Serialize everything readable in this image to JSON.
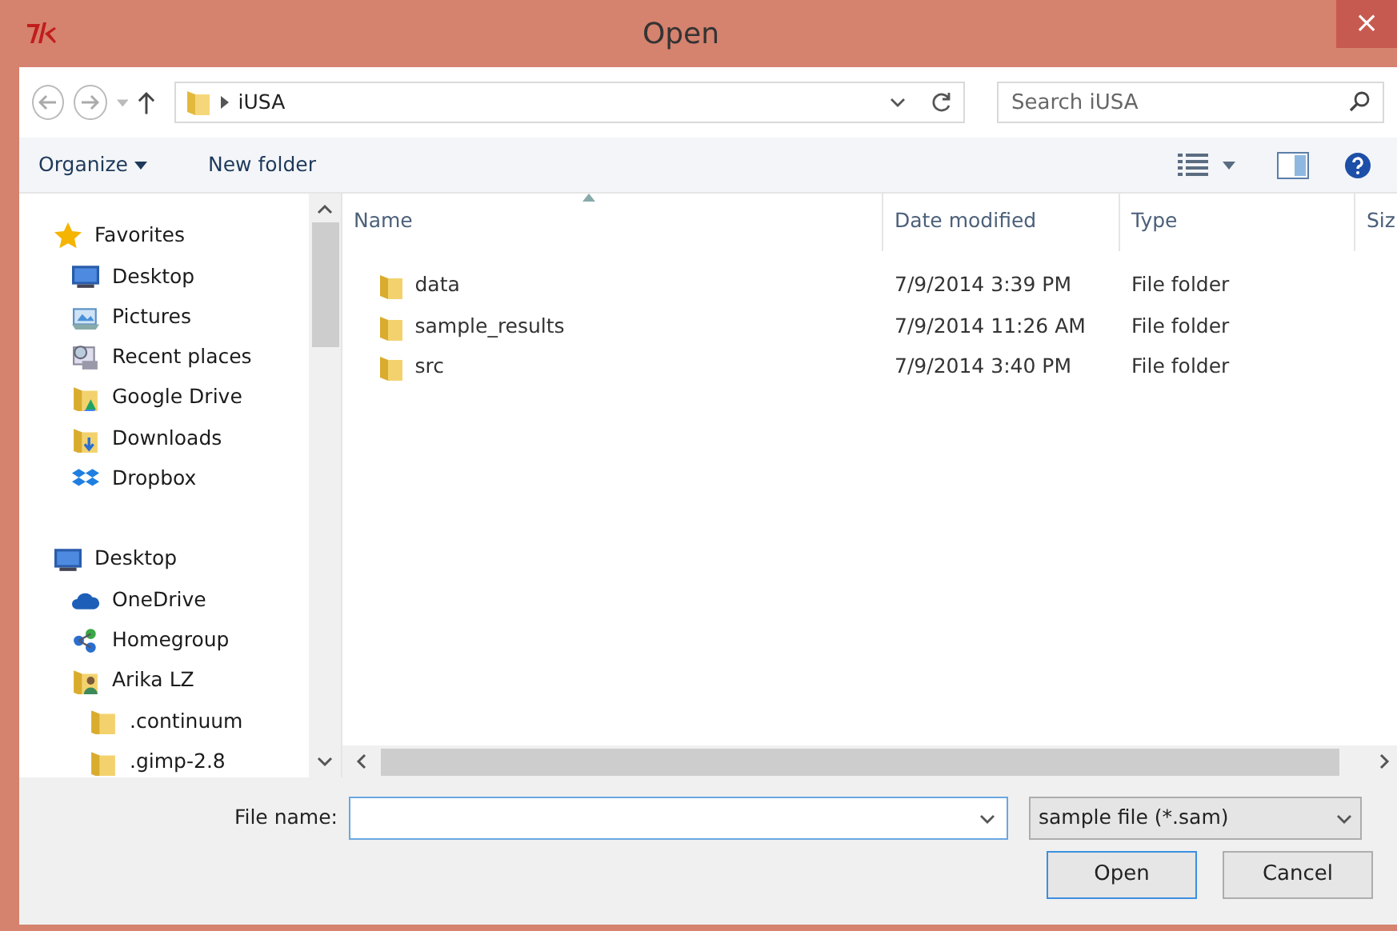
{
  "window": {
    "title": "Open",
    "close": "×"
  },
  "address_bar": {
    "path": "iUSA"
  },
  "search": {
    "placeholder": "Search iUSA"
  },
  "toolbar": {
    "buttons": [
      "Organize",
      "New folder"
    ]
  },
  "sidebar": {
    "groups": [
      {
        "label": "Favorites",
        "children": [
          {
            "label": "Desktop"
          },
          {
            "label": "Pictures"
          },
          {
            "label": "Recent places"
          },
          {
            "label": "Google Drive"
          },
          {
            "label": "Downloads"
          },
          {
            "label": "Dropbox"
          }
        ]
      },
      {
        "label": "Desktop",
        "children": [
          {
            "label": "OneDrive"
          },
          {
            "label": "Homegroup"
          },
          {
            "label": "Arika LZ",
            "children": [
              {
                "label": ".continuum"
              },
              {
                "label": ".gimp-2.8"
              }
            ]
          }
        ]
      }
    ]
  },
  "table": {
    "columns": [
      "Name",
      "Date modified",
      "Type",
      "Siz"
    ],
    "rows": [
      {
        "name": "data",
        "date_modified": "7/9/2014 3:39 PM",
        "type": "File folder"
      },
      {
        "name": "sample_results",
        "date_modified": "7/9/2014 11:26 AM",
        "type": "File folder"
      },
      {
        "name": "src",
        "date_modified": "7/9/2014 3:40 PM",
        "type": "File folder"
      }
    ]
  },
  "file_name": {
    "label": "File name:"
  },
  "file_type": {
    "value": "sample file (*.sam)"
  },
  "buttons": [
    "Open",
    "Cancel"
  ]
}
